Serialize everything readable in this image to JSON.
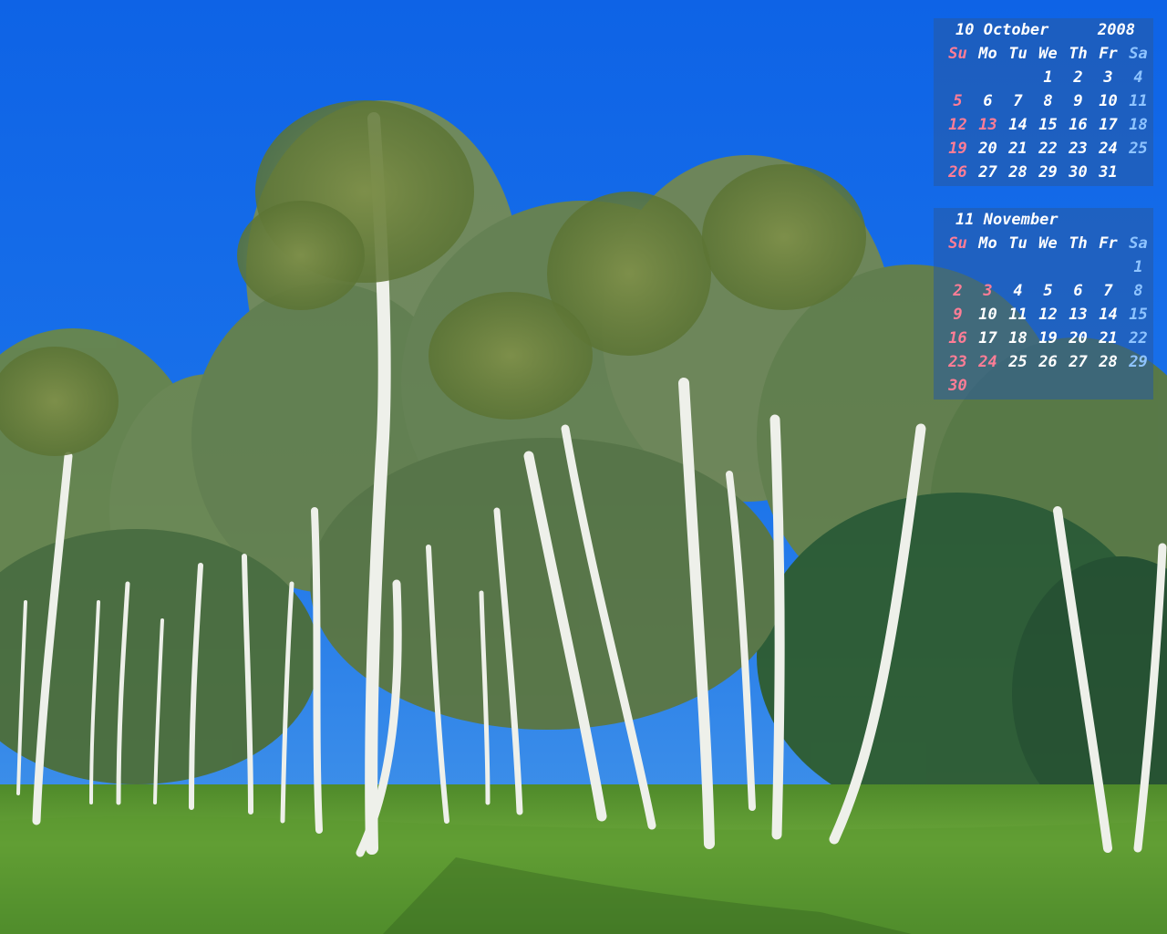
{
  "calendars": [
    {
      "month": "10 October",
      "year": "2008",
      "weekdays": [
        "Su",
        "Mo",
        "Tu",
        "We",
        "Th",
        "Fr",
        "Sa"
      ],
      "weeks": [
        [
          "",
          "",
          "",
          "1",
          "2",
          "3",
          "4"
        ],
        [
          "5",
          "6",
          "7",
          "8",
          "9",
          "10",
          "11"
        ],
        [
          "12",
          "13",
          "14",
          "15",
          "16",
          "17",
          "18"
        ],
        [
          "19",
          "20",
          "21",
          "22",
          "23",
          "24",
          "25"
        ],
        [
          "26",
          "27",
          "28",
          "29",
          "30",
          "31",
          ""
        ]
      ],
      "holidays": [
        "13"
      ]
    },
    {
      "month": "11 November",
      "year": "",
      "weekdays": [
        "Su",
        "Mo",
        "Tu",
        "We",
        "Th",
        "Fr",
        "Sa"
      ],
      "weeks": [
        [
          "",
          "",
          "",
          "",
          "",
          "",
          "1"
        ],
        [
          "2",
          "3",
          "4",
          "5",
          "6",
          "7",
          "8"
        ],
        [
          "9",
          "10",
          "11",
          "12",
          "13",
          "14",
          "15"
        ],
        [
          "16",
          "17",
          "18",
          "19",
          "20",
          "21",
          "22"
        ],
        [
          "23",
          "24",
          "25",
          "26",
          "27",
          "28",
          "29"
        ],
        [
          "30",
          "",
          "",
          "",
          "",
          "",
          ""
        ]
      ],
      "holidays": [
        "3",
        "24"
      ]
    }
  ],
  "colors": {
    "sky": "#1a5fd6",
    "sunday": "#ff7d96",
    "saturday": "#8fc4ff",
    "text": "#ffffff"
  }
}
